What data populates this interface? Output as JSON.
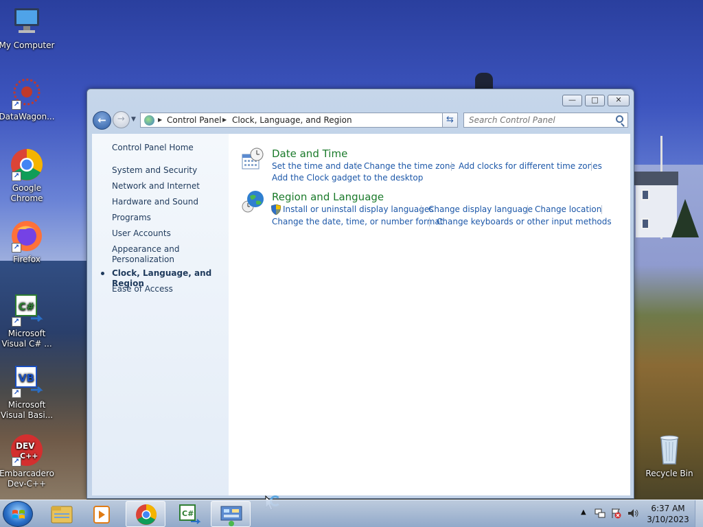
{
  "desktop": {
    "icons": [
      {
        "label": "My Computer",
        "icon": "computer-icon"
      },
      {
        "label": "DataWagon...",
        "icon": "datawagon-icon"
      },
      {
        "label": "Google Chrome",
        "icon": "chrome-icon"
      },
      {
        "label": "Firefox",
        "icon": "firefox-icon"
      },
      {
        "label": "Microsoft Visual C# ...",
        "icon": "visual-csharp-icon"
      },
      {
        "label": "Microsoft Visual Basi...",
        "icon": "visual-basic-icon"
      },
      {
        "label": "Embarcadero Dev-C++",
        "icon": "devcpp-icon"
      },
      {
        "label": "Recycle Bin",
        "icon": "recycle-bin-icon"
      }
    ]
  },
  "window": {
    "controls": {
      "minimize": "—",
      "maximize": "□",
      "close": "✕"
    },
    "nav": {
      "back_glyph": "←",
      "forward_glyph": "→",
      "breadcrumb": [
        "Control Panel",
        "Clock, Language, and Region"
      ],
      "search_placeholder": "Search Control Panel"
    },
    "sidebar": {
      "items": [
        {
          "label": "Control Panel Home",
          "active": false
        },
        {
          "label": "System and Security",
          "active": false
        },
        {
          "label": "Network and Internet",
          "active": false
        },
        {
          "label": "Hardware and Sound",
          "active": false
        },
        {
          "label": "Programs",
          "active": false
        },
        {
          "label": "User Accounts",
          "active": false
        },
        {
          "label": "Appearance and Personalization",
          "active": false
        },
        {
          "label": "Clock, Language, and Region",
          "active": true
        },
        {
          "label": "Ease of Access",
          "active": false
        }
      ]
    },
    "categories": [
      {
        "title": "Date and Time",
        "icon": "clock-calendar-icon",
        "tasks": [
          "Set the time and date",
          "Change the time zone",
          "Add clocks for different time zones",
          "Add the Clock gadget to the desktop"
        ]
      },
      {
        "title": "Region and Language",
        "icon": "globe-clock-icon",
        "tasks": [
          "Install or uninstall display languages",
          "Change display language",
          "Change location",
          "Change the date, time, or number format",
          "Change keyboards or other input methods"
        ]
      }
    ]
  },
  "taskbar": {
    "pinned": [
      "explorer-icon",
      "media-player-icon",
      "chrome-icon",
      "visual-csharp-icon",
      "control-panel-icon"
    ],
    "clock": {
      "time": "6:37 AM",
      "date": "3/10/2023"
    },
    "colors": {
      "accent": "#1c57a8",
      "category_title": "#1a7a2a"
    }
  }
}
